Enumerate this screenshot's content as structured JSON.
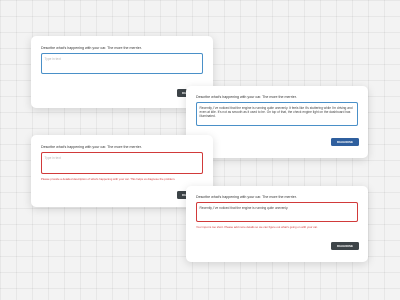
{
  "prompt_label": "Describe what's happening with your car. The more the merrier.",
  "placeholder": "Type in text",
  "button_label": "DIAGNOSE",
  "card_filled": {
    "value": "Recently, I've noticed that the engine is running quite unevenly. It feels like it's stuttering while I'm driving and even at idle. It's not as smooth as it used to be. On top of that, the check engine light on the dashboard has illuminated."
  },
  "card_error_empty": {
    "error": "Please provide a detailed description of what's happening with your car. This helps us diagnose the problem."
  },
  "card_error_short": {
    "value": "Recently, I've noticed that the engine is running quite unevenly.",
    "error": "Your input is too short. Please add more details so we can figure out what's going on with your car."
  },
  "colors": {
    "focus_border": "#4a90c8",
    "error": "#d13a3a",
    "primary_button": "#2f5f9e",
    "dark_button": "#3d4448"
  }
}
